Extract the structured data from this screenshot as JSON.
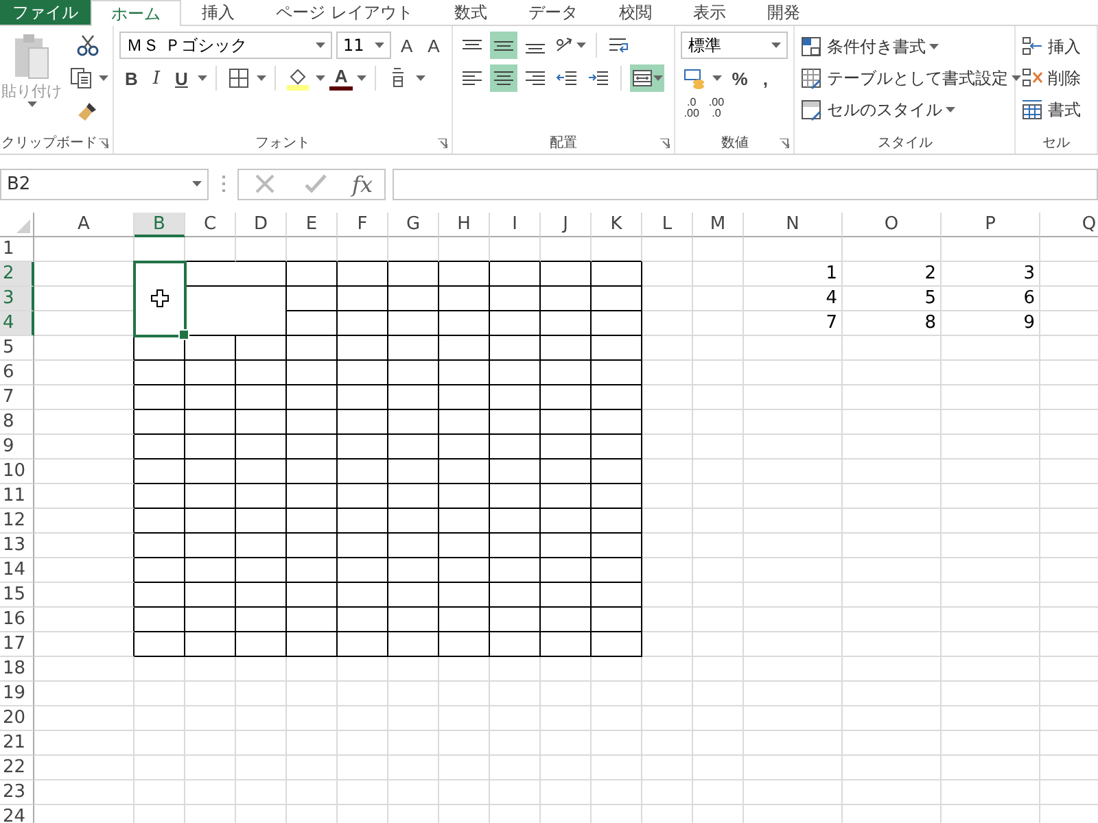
{
  "tabs": [
    {
      "label": "ファイル",
      "kind": "file",
      "selected": false
    },
    {
      "label": "ホーム",
      "kind": "tab",
      "selected": true
    },
    {
      "label": "挿入",
      "kind": "tab",
      "selected": false
    },
    {
      "label": "ページ レイアウト",
      "kind": "tab",
      "selected": false
    },
    {
      "label": "数式",
      "kind": "tab",
      "selected": false
    },
    {
      "label": "データ",
      "kind": "tab",
      "selected": false
    },
    {
      "label": "校閲",
      "kind": "tab",
      "selected": false
    },
    {
      "label": "表示",
      "kind": "tab",
      "selected": false
    },
    {
      "label": "開発",
      "kind": "tab",
      "selected": false
    }
  ],
  "ribbon": {
    "groups": [
      {
        "kind": "clipboard",
        "label": "クリップボード",
        "paste": "貼り付け"
      },
      {
        "kind": "font",
        "label": "フォント",
        "font_name": "ＭＳ Ｐゴシック",
        "font_size": "11",
        "grow": "A",
        "shrink": "A",
        "styles": [
          "B",
          "I",
          "U"
        ],
        "font_color": "A"
      },
      {
        "kind": "alignment",
        "label": "配置",
        "buttons": [
          {
            "kind": "top",
            "on": false
          },
          {
            "kind": "middle",
            "on": true
          },
          {
            "kind": "bottom",
            "on": false
          },
          {
            "kind": "orient",
            "on": false
          },
          {
            "kind": "wrap",
            "on": false
          },
          {
            "kind": "left",
            "on": false
          },
          {
            "kind": "center",
            "on": true
          },
          {
            "kind": "right",
            "on": false
          },
          {
            "kind": "outdent",
            "on": false
          },
          {
            "kind": "indent",
            "on": false
          },
          {
            "kind": "merge",
            "on": true
          }
        ]
      },
      {
        "kind": "number",
        "label": "数値",
        "format": "標準",
        "percent": "%",
        "comma": ",",
        "decimals": [
          {
            "top": ".0",
            "bottom": ".00"
          },
          {
            "top": ".00",
            "bottom": ".0"
          }
        ]
      },
      {
        "kind": "styles",
        "label": "スタイル",
        "items": [
          "条件付き書式",
          "テーブルとして書式設定",
          "セルのスタイル"
        ]
      },
      {
        "kind": "cells",
        "label": "セル",
        "items": [
          "挿入",
          "削除",
          "書式"
        ]
      }
    ]
  },
  "formula_bar": {
    "name_box": "B2",
    "fx": "fx"
  },
  "sheet": {
    "columns": [
      {
        "label": "A",
        "selected": false
      },
      {
        "label": "B",
        "selected": true
      },
      {
        "label": "C",
        "selected": false
      },
      {
        "label": "D",
        "selected": false
      },
      {
        "label": "E",
        "selected": false
      },
      {
        "label": "F",
        "selected": false
      },
      {
        "label": "G",
        "selected": false
      },
      {
        "label": "H",
        "selected": false
      },
      {
        "label": "I",
        "selected": false
      },
      {
        "label": "J",
        "selected": false
      },
      {
        "label": "K",
        "selected": false
      },
      {
        "label": "L",
        "selected": false
      },
      {
        "label": "M",
        "selected": false
      },
      {
        "label": "N",
        "selected": false
      },
      {
        "label": "O",
        "selected": false
      },
      {
        "label": "P",
        "selected": false
      },
      {
        "label": "Q",
        "selected": false
      }
    ],
    "rows": [
      {
        "label": "1",
        "selected": false
      },
      {
        "label": "2",
        "selected": true,
        "values": [
          "1",
          "2",
          "3"
        ]
      },
      {
        "label": "3",
        "selected": true,
        "values": [
          "4",
          "5",
          "6"
        ]
      },
      {
        "label": "4",
        "selected": true,
        "values": [
          "7",
          "8",
          "9"
        ]
      },
      {
        "label": "5",
        "selected": false
      },
      {
        "label": "6",
        "selected": false
      },
      {
        "label": "7",
        "selected": false
      },
      {
        "label": "8",
        "selected": false
      },
      {
        "label": "9",
        "selected": false
      },
      {
        "label": "10",
        "selected": false
      },
      {
        "label": "11",
        "selected": false
      },
      {
        "label": "12",
        "selected": false
      },
      {
        "label": "13",
        "selected": false
      },
      {
        "label": "14",
        "selected": false
      },
      {
        "label": "15",
        "selected": false
      },
      {
        "label": "16",
        "selected": false
      },
      {
        "label": "17",
        "selected": false
      },
      {
        "label": "18",
        "selected": false
      },
      {
        "label": "19",
        "selected": false
      },
      {
        "label": "20",
        "selected": false
      },
      {
        "label": "21",
        "selected": false
      },
      {
        "label": "22",
        "selected": false
      },
      {
        "label": "23",
        "selected": false
      },
      {
        "label": "24",
        "selected": false
      }
    ]
  }
}
